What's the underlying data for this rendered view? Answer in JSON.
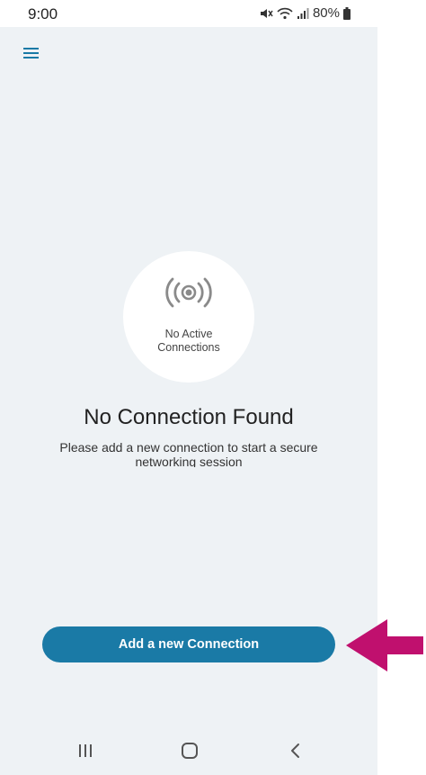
{
  "status_bar": {
    "time": "9:00",
    "battery": "80%",
    "icons": [
      "mute-vibrate-icon",
      "wifi-icon",
      "signal-icon",
      "battery-icon"
    ]
  },
  "header": {
    "menu_icon": "hamburger-menu-icon"
  },
  "empty_state": {
    "icon": "broadcast-signal-icon",
    "circle_label_line1": "No Active",
    "circle_label_line2": "Connections",
    "title": "No Connection Found",
    "subtitle_line1": "Please add a new connection to start a secure",
    "subtitle_line2": "networking session"
  },
  "actions": {
    "add_connection_label": "Add a new Connection"
  },
  "nav_bar": {
    "recents_icon": "recents-icon",
    "home_icon": "home-icon",
    "back_icon": "back-icon"
  },
  "colors": {
    "background": "#eef2f5",
    "primary": "#1a7aa6",
    "arrow_annotation": "#c0106e"
  }
}
